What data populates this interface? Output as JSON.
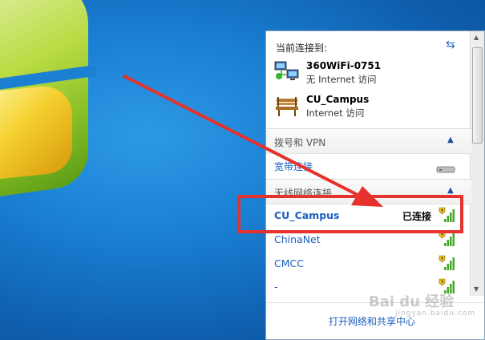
{
  "panel": {
    "header": "当前连接到:",
    "current_connections": [
      {
        "name": "360WiFi-0751",
        "status": "无 Internet 访问",
        "icon": "network-computers-icon"
      },
      {
        "name": "CU_Campus",
        "status": "Internet 访问",
        "icon": "bench-network-icon"
      }
    ],
    "dialup_section": {
      "title": "拨号和 VPN",
      "link": "宽带连接"
    },
    "wireless_section": {
      "title": "无线网络连接",
      "networks": [
        {
          "name": "CU_Campus",
          "status": "已连接"
        },
        {
          "name": "ChinaNet",
          "status": ""
        },
        {
          "name": "CMCC",
          "status": ""
        },
        {
          "name": "-",
          "status": ""
        }
      ]
    },
    "footer_link": "打开网络和共享中心"
  },
  "watermark": {
    "brand": "Bai du 经验",
    "sub": "jingyan.baidu.com"
  },
  "colors": {
    "highlight": "#e5322c",
    "link": "#1b5fbf",
    "desktop": "#1a7fd3"
  }
}
